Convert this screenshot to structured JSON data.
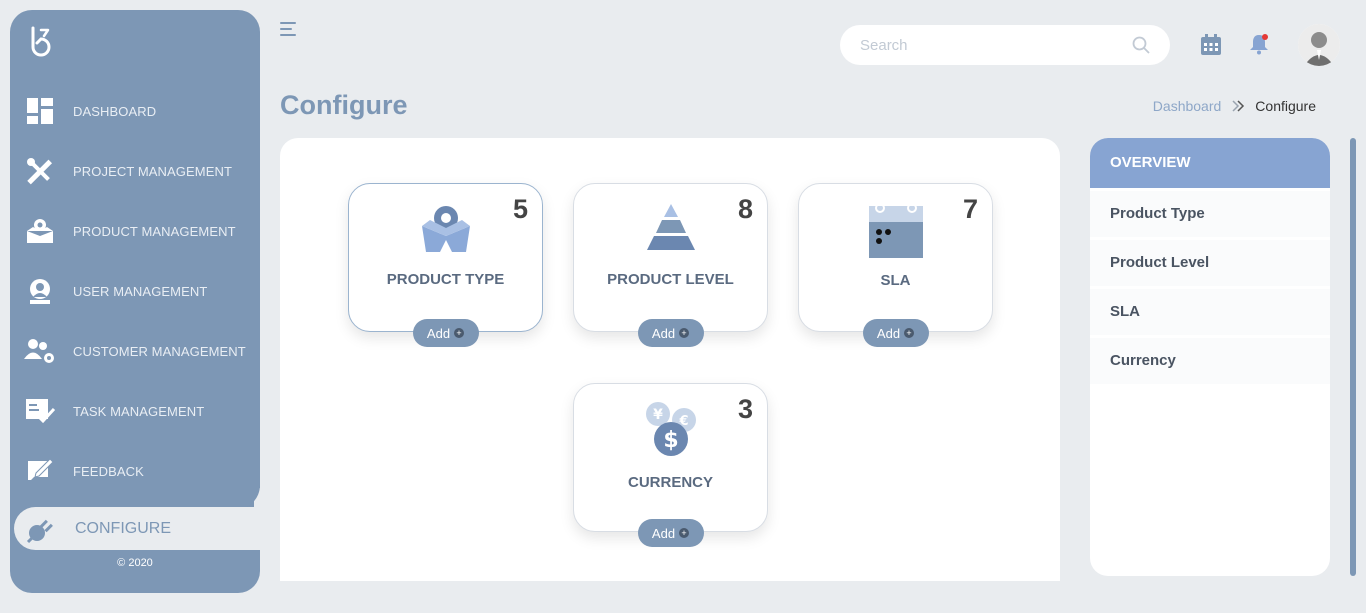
{
  "sidebar": {
    "items": [
      {
        "label": "DASHBOARD",
        "icon": "dashboard-icon"
      },
      {
        "label": "PROJECT MANAGEMENT",
        "icon": "tools-icon"
      },
      {
        "label": "PRODUCT MANAGEMENT",
        "icon": "box-gear-icon"
      },
      {
        "label": "USER MANAGEMENT",
        "icon": "user-gear-icon"
      },
      {
        "label": "CUSTOMER MANAGEMENT",
        "icon": "users-gear-icon"
      },
      {
        "label": "TASK MANAGEMENT",
        "icon": "task-check-icon"
      },
      {
        "label": "FEEDBACK",
        "icon": "feedback-icon"
      },
      {
        "label": "CONFIGURE",
        "icon": "plug-icon",
        "active": true
      }
    ],
    "copyright": "© 2020"
  },
  "header": {
    "search_placeholder": "Search"
  },
  "page": {
    "title": "Configure",
    "breadcrumb": {
      "parent": "Dashboard",
      "current": "Configure"
    }
  },
  "tiles": [
    {
      "name": "PRODUCT TYPE",
      "count": "5",
      "add": "Add",
      "icon": "box-gear-icon"
    },
    {
      "name": "PRODUCT LEVEL",
      "count": "8",
      "add": "Add",
      "icon": "pyramid-icon"
    },
    {
      "name": "SLA",
      "count": "7",
      "add": "Add",
      "icon": "calendar-icon"
    },
    {
      "name": "CURRENCY",
      "count": "3",
      "add": "Add",
      "icon": "currency-icon"
    }
  ],
  "overview": {
    "title": "OVERVIEW",
    "items": [
      "Product Type",
      "Product Level",
      "SLA",
      "Currency"
    ]
  },
  "colors": {
    "sidebar": "#7d97b5",
    "accent": "#87a4d2",
    "background": "#e9ecef"
  }
}
